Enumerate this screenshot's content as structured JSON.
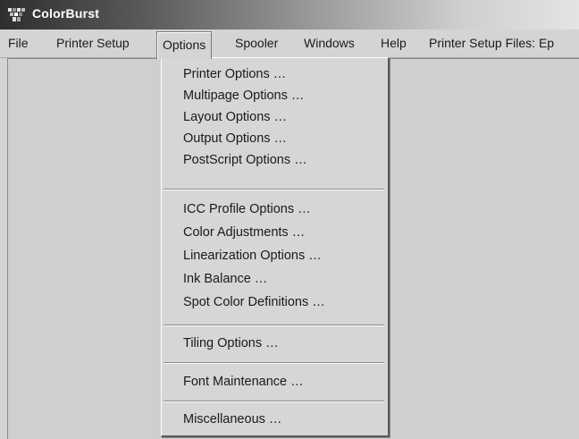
{
  "window": {
    "title": "ColorBurst"
  },
  "menubar": {
    "items": [
      "File",
      "Printer Setup",
      "Options",
      "Spooler",
      "Windows",
      "Help",
      "Printer Setup Files: Ep"
    ]
  },
  "options_menu": {
    "groups": [
      [
        "Printer Options …",
        "Multipage Options …",
        "Layout Options …",
        "Output Options …",
        "PostScript Options …"
      ],
      [
        "ICC Profile Options …",
        "Color Adjustments …",
        "Linearization Options …",
        "Ink Balance …",
        "Spot Color Definitions …"
      ],
      [
        "Tiling Options …"
      ],
      [
        "Font Maintenance …"
      ],
      [
        "Miscellaneous …"
      ]
    ]
  },
  "colors": {
    "menu_background": "#d6d6d6",
    "title_text": "#ffffff"
  },
  "icons": [
    "colorburst-app-icon"
  ]
}
